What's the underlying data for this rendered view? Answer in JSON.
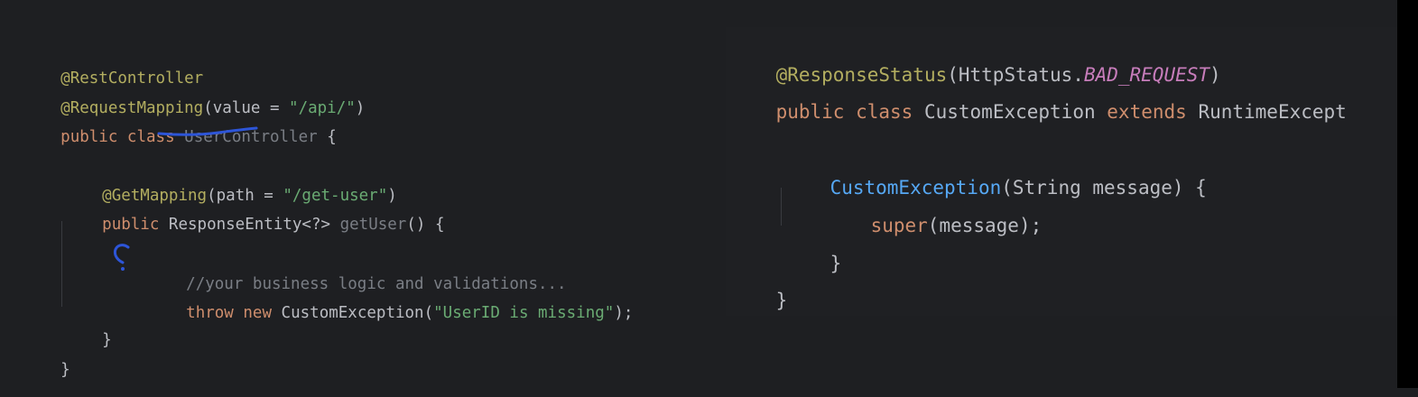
{
  "left_code": {
    "rest_controller": "@RestController",
    "request_mapping_ann": "@RequestMapping",
    "request_mapping_args_open": "(value = ",
    "request_mapping_value": "\"/api/\"",
    "paren_close": ")",
    "kw_public": "public",
    "kw_class": "class",
    "class_name": "UserController",
    "brace_open": "{",
    "get_mapping_ann": "@GetMapping",
    "get_mapping_args_open": "(path = ",
    "get_mapping_value": "\"/get-user\"",
    "return_type": "ResponseEntity<?>",
    "method_name": "getUser",
    "method_sig_tail": "() {",
    "comment": "//your business logic and validations...",
    "kw_throw": "throw",
    "kw_new": "new",
    "exception_ctor": "CustomException(",
    "exception_msg": "\"UserID is missing\"",
    "stmt_end": ");",
    "brace_close": "}"
  },
  "right_code": {
    "response_status_ann": "@ResponseStatus",
    "response_status_open": "(HttpStatus.",
    "status_const": "BAD_REQUEST",
    "paren_close": ")",
    "kw_public": "public",
    "kw_class": "class",
    "class_name": "CustomException",
    "kw_extends": "extends",
    "parent_class": "RuntimeExcept",
    "ctor_name": "CustomException",
    "ctor_params": "(String message) {",
    "kw_super": "super",
    "super_args": "(message);",
    "brace_close": "}"
  },
  "colors": {
    "background": "#1e1f22",
    "annotation": "#b3ae60",
    "keyword": "#cf8e6d",
    "string": "#6aab73",
    "method": "#56a8f5",
    "constant": "#c77dbb",
    "pen": "#2d55d8"
  }
}
